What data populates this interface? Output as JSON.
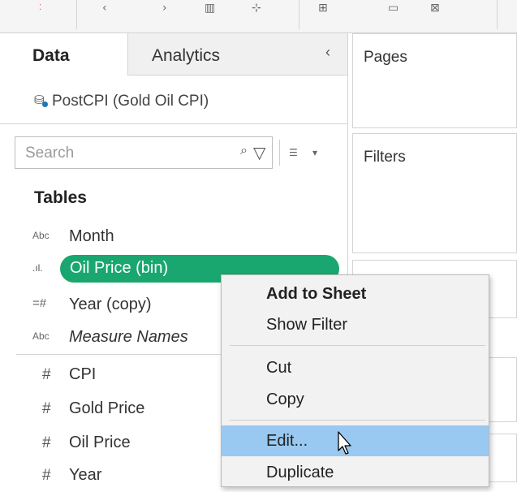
{
  "toolbar": {
    "icons": [
      "show-start-icon",
      "undo-icon",
      "redo-icon",
      "new-datasource-icon",
      "add-sheet-icon",
      "new-dashboard-icon",
      "duplicate-icon",
      "clear-sheet-icon"
    ]
  },
  "panel": {
    "tabs": {
      "data": "Data",
      "analytics": "Analytics",
      "collapse_symbol": "‹"
    },
    "datasource": "PostCPI (Gold Oil CPI)",
    "search": {
      "placeholder": "Search"
    },
    "tables_heading": "Tables",
    "fields": {
      "month": {
        "type": "Abc",
        "name": "Month"
      },
      "oil_bin": {
        "type": ".ıl.",
        "name": "Oil Price (bin)"
      },
      "year_copy": {
        "type": "=#",
        "name": "Year (copy)"
      },
      "measure_names": {
        "type": "Abc",
        "name": "Measure Names"
      },
      "cpi": {
        "type": "#",
        "name": "CPI"
      },
      "gold_price": {
        "type": "#",
        "name": "Gold Price"
      },
      "oil_price": {
        "type": "#",
        "name": "Oil Price"
      },
      "year": {
        "type": "#",
        "name": "Year"
      }
    }
  },
  "shelves": {
    "pages": "Pages",
    "filters": "Filters"
  },
  "context_menu": {
    "add_to_sheet": "Add to Sheet",
    "show_filter": "Show Filter",
    "cut": "Cut",
    "copy": "Copy",
    "edit": "Edit...",
    "duplicate": "Duplicate"
  },
  "colors": {
    "selected_pill": "#19a76f",
    "menu_highlight": "#99c9f0"
  }
}
